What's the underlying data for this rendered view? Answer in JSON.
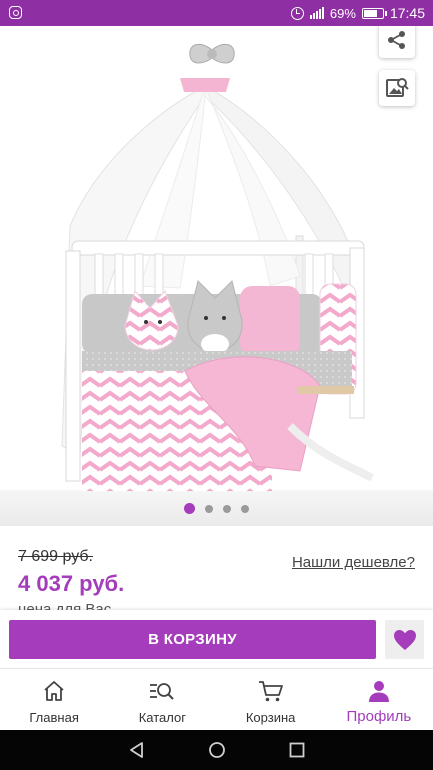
{
  "status_bar": {
    "battery": "69%",
    "time": "17:45",
    "signal_label": "4G"
  },
  "gallery": {
    "image_alt": "Baby crib bedding set with canopy and cat pillows",
    "dots_total": 4,
    "dots_active_index": 0
  },
  "product": {
    "old_price": "7 699 руб.",
    "new_price": "4 037 руб.",
    "price_note": "цена для Вас",
    "found_cheaper_link": "Нашли дешевле?"
  },
  "actions": {
    "add_to_cart": "В КОРЗИНУ"
  },
  "bottom_nav": {
    "items": [
      {
        "label": "Главная",
        "icon": "home-icon"
      },
      {
        "label": "Каталог",
        "icon": "catalog-search-icon"
      },
      {
        "label": "Корзина",
        "icon": "cart-icon"
      },
      {
        "label": "Профиль",
        "icon": "profile-icon"
      }
    ],
    "active_index": 3
  },
  "colors": {
    "brand": "#a43cbb",
    "status_bar": "#8e2fa3"
  }
}
